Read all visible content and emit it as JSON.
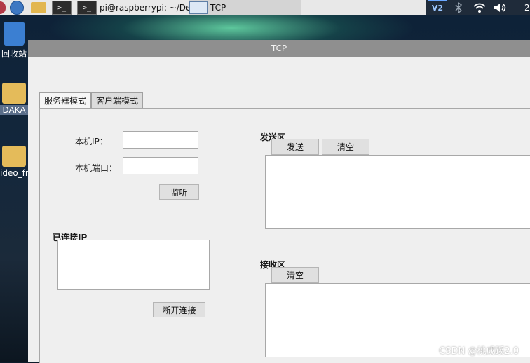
{
  "taskbar": {
    "terminal_title": "pi@raspberrypi: ~/De...",
    "tcp_title": "TCP",
    "clock_fragment": "2",
    "vnc_label": "V2"
  },
  "desktop": {
    "trash_label": "回收站",
    "folder1_label": "DAKA",
    "folder2_label": "ideo_fre"
  },
  "window": {
    "title": "TCP",
    "tabs": [
      {
        "label": "服务器模式",
        "active": true
      },
      {
        "label": "客户端模式",
        "active": false
      }
    ],
    "server": {
      "ip_label": "本机IP：",
      "ip_value": "",
      "port_label": "本机端口：",
      "port_value": "",
      "listen_button": "监听",
      "connected_label": "已连接IP",
      "disconnect_button": "断开连接",
      "send_section_label": "发送区",
      "send_button": "发送",
      "send_clear_button": "清空",
      "send_text": "",
      "recv_section_label": "接收区",
      "recv_clear_button": "清空",
      "recv_text": ""
    }
  },
  "watermark": "CSDN @桃成蹊2.0"
}
